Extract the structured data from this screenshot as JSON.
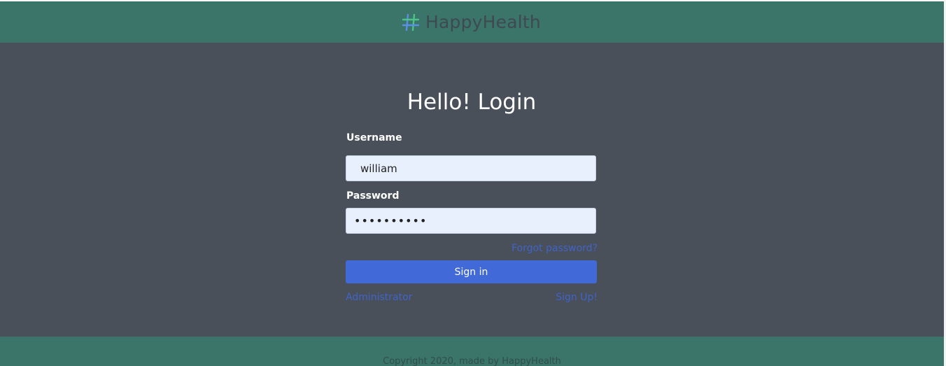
{
  "header": {
    "brand_icon": "hash-icon",
    "brand_name": "HappyHealth"
  },
  "login": {
    "title": "Hello! Login",
    "username_label": "Username",
    "username_value": "william",
    "password_label": "Password",
    "password_value": "••••••••••",
    "forgot_link": "Forgot password?",
    "signin_label": "Sign in",
    "admin_link": "Administrator",
    "signup_link": "Sign Up!"
  },
  "footer": {
    "copyright": "Copyright 2020, made by HappyHealth"
  },
  "colors": {
    "header_bg": "#3b7468",
    "main_bg": "#4a5059",
    "accent": "#4169d8",
    "link": "#3f63c9"
  }
}
